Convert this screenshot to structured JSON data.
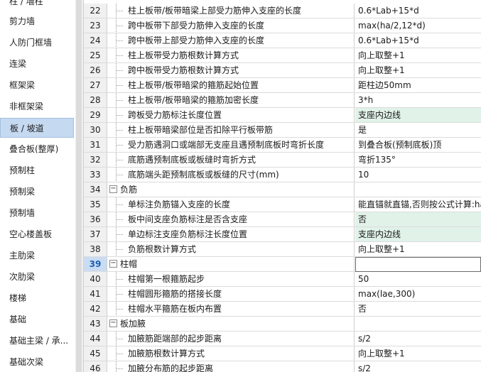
{
  "sidebar": {
    "items": [
      {
        "label": "柱 / 墙柱",
        "active": false
      },
      {
        "label": "剪力墙",
        "active": false
      },
      {
        "label": "人防门框墙",
        "active": false
      },
      {
        "label": "连梁",
        "active": false
      },
      {
        "label": "框架梁",
        "active": false
      },
      {
        "label": "非框架梁",
        "active": false
      },
      {
        "label": "板 / 坡道",
        "active": true
      },
      {
        "label": "叠合板(整厚)",
        "active": false
      },
      {
        "label": "预制柱",
        "active": false
      },
      {
        "label": "预制梁",
        "active": false
      },
      {
        "label": "预制墙",
        "active": false
      },
      {
        "label": "空心楼盖板",
        "active": false
      },
      {
        "label": "主肋梁",
        "active": false
      },
      {
        "label": "次肋梁",
        "active": false
      },
      {
        "label": "楼梯",
        "active": false
      },
      {
        "label": "基础",
        "active": false
      },
      {
        "label": "基础主梁 / 承...",
        "active": false
      },
      {
        "label": "基础次梁",
        "active": false
      }
    ]
  },
  "grid": {
    "rows": [
      {
        "no": "22",
        "type": "child",
        "name": "柱上板带/板带暗梁上部受力筋伸入支座的长度",
        "value": "0.6*Lab+15*d",
        "highlight": false
      },
      {
        "no": "23",
        "type": "child",
        "name": "跨中板带下部受力筋伸入支座的长度",
        "value": "max(ha/2,12*d)",
        "highlight": false
      },
      {
        "no": "24",
        "type": "child",
        "name": "跨中板带上部受力筋伸入支座的长度",
        "value": "0.6*Lab+15*d",
        "highlight": false
      },
      {
        "no": "25",
        "type": "child",
        "name": "柱上板带受力筋根数计算方式",
        "value": "向上取整+1",
        "highlight": false
      },
      {
        "no": "26",
        "type": "child",
        "name": "跨中板带受力筋根数计算方式",
        "value": "向上取整+1",
        "highlight": false
      },
      {
        "no": "27",
        "type": "child",
        "name": "柱上板带/板带暗梁的箍筋起始位置",
        "value": "距柱边50mm",
        "highlight": false
      },
      {
        "no": "28",
        "type": "child",
        "name": "柱上板带/板带暗梁的箍筋加密长度",
        "value": "3*h",
        "highlight": false
      },
      {
        "no": "29",
        "type": "child",
        "name": "跨板受力筋标注长度位置",
        "value": "支座内边线",
        "highlight": true
      },
      {
        "no": "30",
        "type": "child",
        "name": "柱上板带暗梁部位是否扣除平行板带筋",
        "value": "是",
        "highlight": false
      },
      {
        "no": "31",
        "type": "child",
        "name": "受力筋遇洞口或端部无支座且遇预制底板时弯折长度",
        "value": "到叠合板(预制底板)顶",
        "highlight": false
      },
      {
        "no": "32",
        "type": "child",
        "name": "底筋遇预制底板或板缝时弯折方式",
        "value": "弯折135°",
        "highlight": false
      },
      {
        "no": "33",
        "type": "child",
        "name": "底筋端头距预制底板或板缝的尺寸(mm)",
        "value": "10",
        "highlight": false
      },
      {
        "no": "34",
        "type": "group",
        "name": "负筋",
        "value": "",
        "highlight": false
      },
      {
        "no": "35",
        "type": "child",
        "name": "单标注负筋锚入支座的长度",
        "value": "能直锚就直锚,否则按公式计算:ha",
        "highlight": false
      },
      {
        "no": "36",
        "type": "child",
        "name": "板中间支座负筋标注是否含支座",
        "value": "否",
        "highlight": true
      },
      {
        "no": "37",
        "type": "child",
        "name": "单边标注支座负筋标注长度位置",
        "value": "支座内边线",
        "highlight": true
      },
      {
        "no": "38",
        "type": "child",
        "name": "负筋根数计算方式",
        "value": "向上取整+1",
        "highlight": false
      },
      {
        "no": "39",
        "type": "group",
        "name": "柱帽",
        "value": "",
        "highlight": false,
        "current": true
      },
      {
        "no": "40",
        "type": "child",
        "name": "柱帽第一根箍筋起步",
        "value": "50",
        "highlight": false
      },
      {
        "no": "41",
        "type": "child",
        "name": "柱帽圆形箍筋的搭接长度",
        "value": "max(lae,300)",
        "highlight": false
      },
      {
        "no": "42",
        "type": "child",
        "name": "柱帽水平箍筋在板内布置",
        "value": "否",
        "highlight": false
      },
      {
        "no": "43",
        "type": "group",
        "name": "板加腋",
        "value": "",
        "highlight": false
      },
      {
        "no": "44",
        "type": "child",
        "name": "加腋筋距端部的起步距离",
        "value": "s/2",
        "highlight": false
      },
      {
        "no": "45",
        "type": "child",
        "name": "加腋筋根数计算方式",
        "value": "向上取整+1",
        "highlight": false
      },
      {
        "no": "46",
        "type": "child",
        "name": "加腋分布筋的起步距离",
        "value": "s/2",
        "highlight": false
      }
    ],
    "collapse_glyph": "−"
  }
}
